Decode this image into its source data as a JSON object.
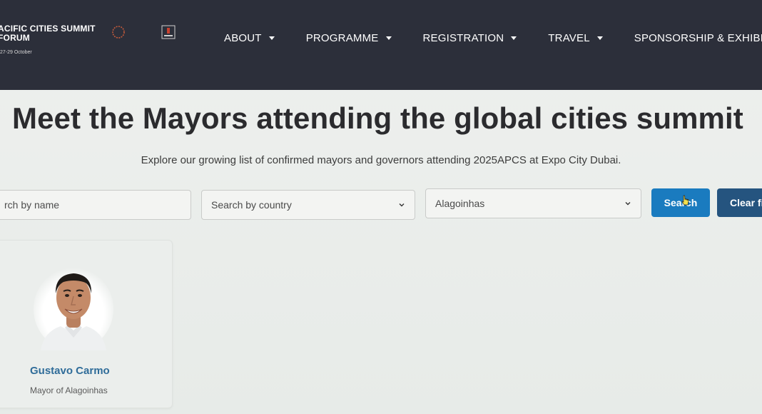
{
  "header": {
    "brand_title": "ACIFIC CITIES SUMMIT\nFORUM",
    "brand_dates": "27-29 October",
    "nav": [
      {
        "label": "ABOUT",
        "has_dropdown": true
      },
      {
        "label": "PROGRAMME",
        "has_dropdown": true
      },
      {
        "label": "REGISTRATION",
        "has_dropdown": true
      },
      {
        "label": "TRAVEL",
        "has_dropdown": true
      },
      {
        "label": "SPONSORSHIP & EXHIBITION",
        "has_dropdown": false
      }
    ]
  },
  "main": {
    "title": "Meet the Mayors attending the global cities summit",
    "subtitle": "Explore our growing list of confirmed mayors and governors attending 2025APCS at Expo City Dubai."
  },
  "filters": {
    "name_placeholder": "rch by name",
    "country_placeholder": "Search by country",
    "city_selected": "Alagoinhas",
    "search_label": "Search",
    "clear_label": "Clear fi"
  },
  "results": [
    {
      "name": "Gustavo Carmo",
      "role": "Mayor of Alagoinhas"
    }
  ],
  "colors": {
    "header_bg": "#2c2f3a",
    "search_button": "#1a7bbf",
    "clear_button": "#25547f",
    "name_link": "#2f6c99"
  },
  "icons": {
    "nav_dropdown": "caret-down-icon",
    "select": "chevron-down-icon",
    "cursor": "pointer-cursor-icon"
  }
}
